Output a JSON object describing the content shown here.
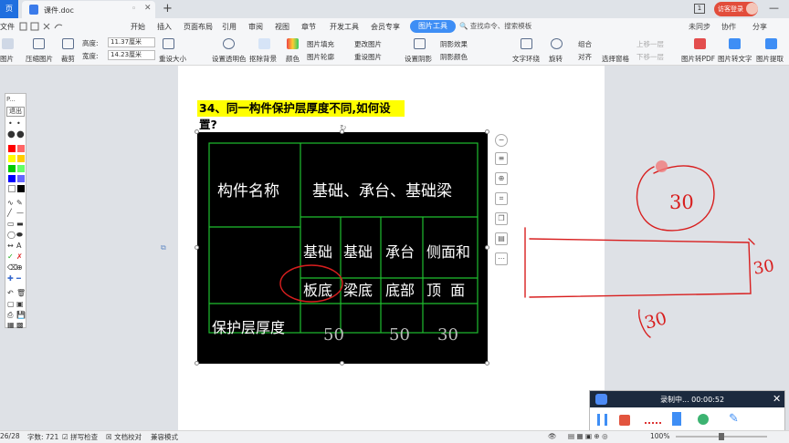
{
  "titlebar": {
    "home_tab": "页",
    "doc_tab": "课件.doc",
    "add_tab": "+",
    "window_count": "1",
    "login_label": "访客登录",
    "minimize": "—"
  },
  "menu": {
    "file": "文件",
    "items": [
      "开始",
      "插入",
      "页面布局",
      "引用",
      "审阅",
      "视图",
      "章节",
      "开发工具",
      "会员专享"
    ],
    "active": "图片工具",
    "search_placeholder": "查找命令、搜索模板",
    "right": [
      "未同步",
      "协作",
      "分享"
    ]
  },
  "ribbon": {
    "left_cut": "图片",
    "compress": "压缩图片",
    "crop": "裁剪",
    "height_label": "高度:",
    "height_value": "11.37厘米",
    "width_label": "宽度:",
    "width_value": "14.23厘米",
    "reset_size": "重设大小",
    "transparent": "设置透明色",
    "remove_bg": "抠除背景",
    "color": "颜色",
    "fill": "图片填充",
    "outline": "图片轮廓",
    "change_pic": "更改图片",
    "reset_pic": "重设图片",
    "shadow": "设置阴影",
    "shadow_effect": "阴影效果",
    "shadow_color": "阴影颜色",
    "wrap": "文字环绕",
    "rotate": "旋转",
    "group": "组合",
    "align": "对齐",
    "selection_pane": "选择窗格",
    "move_up": "上移一层",
    "move_down": "下移一层",
    "to_pdf": "图片转PDF",
    "to_text": "图片转文字",
    "extract": "图片提取"
  },
  "document": {
    "heading": "34、同一构件保护层厚度不同,如何设置?",
    "table": {
      "header_left": "构件名称",
      "header_right": "基础、承台、基础梁",
      "col1_a": "基础",
      "col1_b": "板底",
      "col2_a": "基础",
      "col2_b": "梁底",
      "col3_a": "承台",
      "col3_b": "底部",
      "col4_a": "侧面和",
      "col4_b": "顶  面",
      "row_label": "保护层厚度",
      "values": [
        "50",
        "50",
        "30"
      ]
    },
    "annotations": {
      "circle_top": "30",
      "right_number": "30",
      "bottom_number": "30"
    }
  },
  "draw_toolbar": {
    "title": "P...",
    "exit": "退出",
    "colors": [
      "#ff0000",
      "#ff6666",
      "#ffff00",
      "#ffcc00",
      "#00cc00",
      "#66ff66",
      "#0000ff",
      "#6666ff",
      "#ffffff",
      "#000000"
    ]
  },
  "recorder": {
    "title": "录制中... 00:00:52"
  },
  "status": {
    "page": "26/28",
    "words": "字数: 721",
    "spell": "拼写检查",
    "proof": "文档校对",
    "compat": "兼容模式",
    "zoom": "100%"
  },
  "colors": {
    "accent": "#3e8ef5",
    "heading_bg": "#ffff00",
    "table_line": "#1fbf2f",
    "ink": "#d81e1e"
  }
}
